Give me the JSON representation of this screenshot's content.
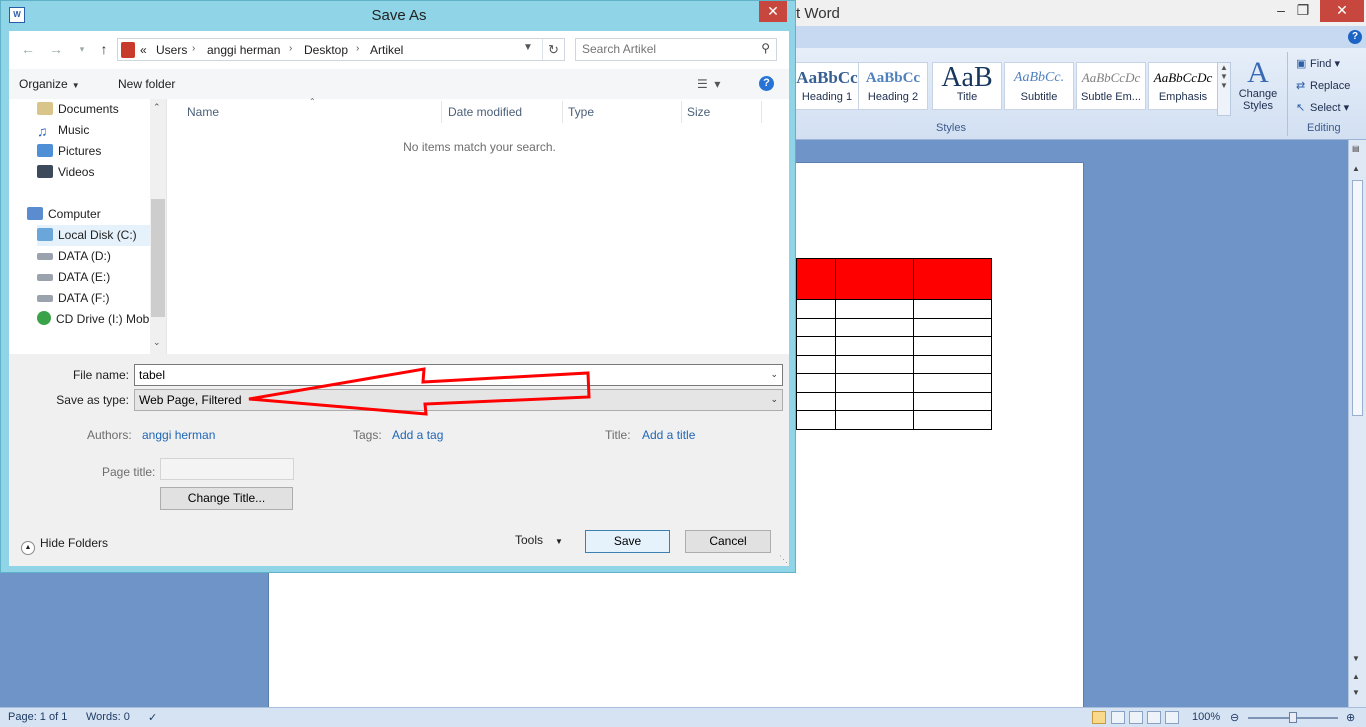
{
  "word": {
    "title_fragment": "t Word",
    "styles": [
      {
        "sample": "AaBbCc",
        "label": "Heading 1"
      },
      {
        "sample": "AaBbCc",
        "label": "Heading 2"
      },
      {
        "sample": "AaB",
        "label": "Title"
      },
      {
        "sample": "AaBbCc.",
        "label": "Subtitle"
      },
      {
        "sample": "AaBbCcDc",
        "label": "Subtle Em..."
      },
      {
        "sample": "AaBbCcDc",
        "label": "Emphasis"
      }
    ],
    "styles_group_label": "Styles",
    "change_styles_label": "Change Styles",
    "editing": {
      "find": "Find",
      "replace": "Replace",
      "select": "Select",
      "group_label": "Editing"
    },
    "status": {
      "page": "Page: 1 of 1",
      "words": "Words: 0",
      "zoom": "100%"
    },
    "table_header_color": "#ff0000"
  },
  "dialog": {
    "title": "Save As",
    "breadcrumb": [
      "«",
      "Users",
      "anggi herman",
      "Desktop",
      "Artikel"
    ],
    "search_placeholder": "Search Artikel",
    "toolbar": {
      "organize": "Organize",
      "new_folder": "New folder"
    },
    "nav_items": [
      {
        "label": "Documents",
        "icon": "documents-icon"
      },
      {
        "label": "Music",
        "icon": "music-icon"
      },
      {
        "label": "Pictures",
        "icon": "pictures-icon"
      },
      {
        "label": "Videos",
        "icon": "videos-icon"
      },
      {
        "label": "Computer",
        "icon": "computer-icon"
      },
      {
        "label": "Local Disk (C:)",
        "icon": "local-disk-icon"
      },
      {
        "label": "DATA (D:)",
        "icon": "drive-icon"
      },
      {
        "label": "DATA (E:)",
        "icon": "drive-icon"
      },
      {
        "label": "DATA (F:)",
        "icon": "drive-icon"
      },
      {
        "label": "CD Drive (I:) Mob",
        "icon": "cd-drive-icon"
      }
    ],
    "columns": [
      "Name",
      "Date modified",
      "Type",
      "Size"
    ],
    "empty_message": "No items match your search.",
    "form": {
      "file_name_label": "File name:",
      "file_name_value": "tabel",
      "save_type_label": "Save as type:",
      "save_type_value": "Web Page, Filtered",
      "authors_label": "Authors:",
      "authors_value": "anggi herman",
      "tags_label": "Tags:",
      "tags_value": "Add a tag",
      "title_label": "Title:",
      "title_value": "Add a title",
      "page_title_label": "Page title:",
      "change_title_button": "Change Title..."
    },
    "footer": {
      "hide_folders": "Hide Folders",
      "tools": "Tools",
      "save": "Save",
      "cancel": "Cancel"
    },
    "annotation_color": "#ff0000"
  }
}
